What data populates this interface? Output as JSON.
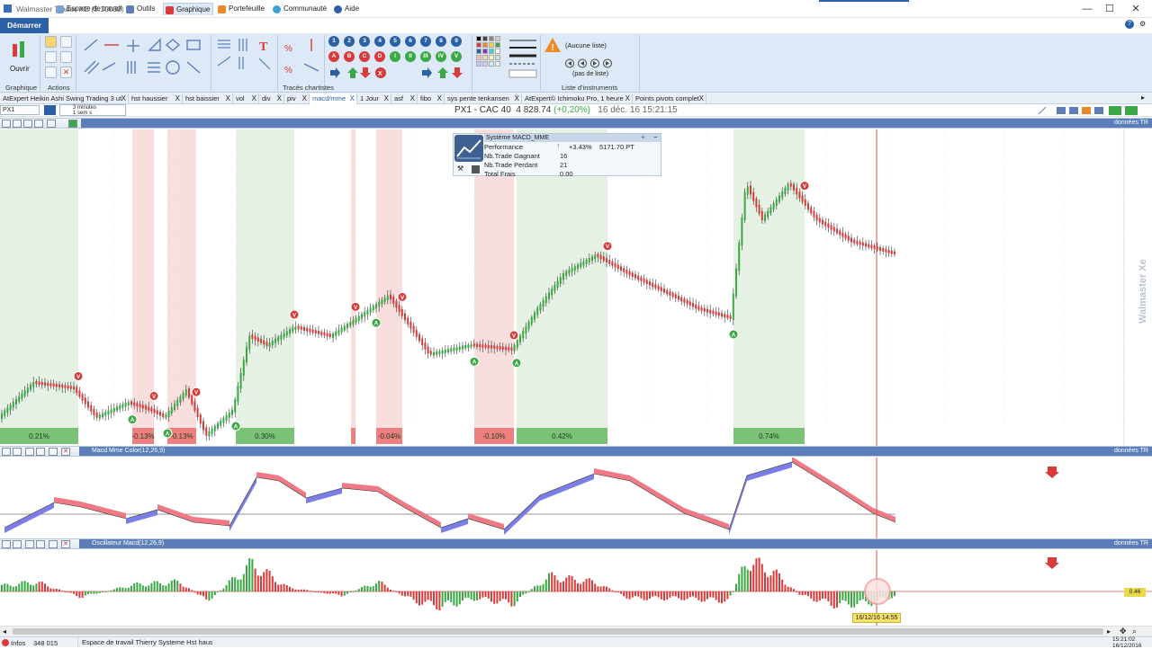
{
  "app": {
    "title": "Walmaster Trader XE",
    "version": "(5.10032)",
    "window_controls": [
      "—",
      "☐",
      "✕"
    ]
  },
  "menu": {
    "start": "Démarrer",
    "items": [
      "Espace de travail",
      "Outils",
      "Graphique",
      "Portefeuille",
      "Communauté",
      "Aide"
    ]
  },
  "ribbon": {
    "open_label": "Ouvrir",
    "graphique_label": "Graphique",
    "actions_label": "Actions",
    "traces_label": "Tracés chartistes",
    "liste_label": "Liste d'instruments",
    "aucune_liste": "(Aucune liste)",
    "pas_de_liste": "(pas de liste)",
    "signal_letters": [
      "A",
      "B",
      "C",
      "D",
      "I",
      "II",
      "III",
      "IV",
      "V",
      "X"
    ]
  },
  "tabs": [
    "AtExpert Heikin Ashi Swing Trading 3 ut",
    "hst haussier",
    "hst baissier",
    "vol",
    "div",
    "piv",
    "macd/mme",
    "1 Jour",
    "asf",
    "fibo",
    "sys pente tenkansen",
    "AtExpert© Ichimoku Pro, 1 heure",
    "Points pivots complet"
  ],
  "active_tab": "macd/mme",
  "instrument": {
    "code": "PX1",
    "line": "PX1 - CAC 40",
    "price": "4 828.74",
    "change": "(+0,20%)",
    "datetime": "16 déc. 16 15:21:15",
    "timeframe": "3 minutes",
    "timeframe2": "1 sem s"
  },
  "system": {
    "header": "Système MACD_MME",
    "rows": [
      {
        "label": "Performance",
        "v1": "+3.43%",
        "v2": "5171.70 PT"
      },
      {
        "label": "Nb.Trade Gagnant",
        "v1": "16",
        "v2": ""
      },
      {
        "label": "Nb.Trade Perdant",
        "v1": "21",
        "v2": ""
      },
      {
        "label": "Total Frais",
        "v1": "0.00",
        "v2": ""
      }
    ]
  },
  "panes": {
    "donnees": "données TR",
    "macd_title": "Macd Mme Color(12,26,9)",
    "osc_title": "Oscillateur Macd(12,26,9)",
    "osc_value": "0.46",
    "cursor_date": "16/12/16 14:55"
  },
  "zone_labels": [
    "0.21%",
    "-0.13%",
    "0.30%",
    "-0.04%",
    "-0.10%",
    "0.42%",
    "0.74%"
  ],
  "brand": "Walmaster Xe",
  "status": {
    "infos": "Infos",
    "count": "348 015",
    "workspace": "Espace de travail Thierry Systeme Hst haus...",
    "time": "15:21:02",
    "date": "16/12/2016"
  },
  "colors": {
    "bull": "#3aa845",
    "bear": "#d93a3a",
    "accent": "#2b5fa6",
    "pane_header": "#5c7eb8"
  }
}
